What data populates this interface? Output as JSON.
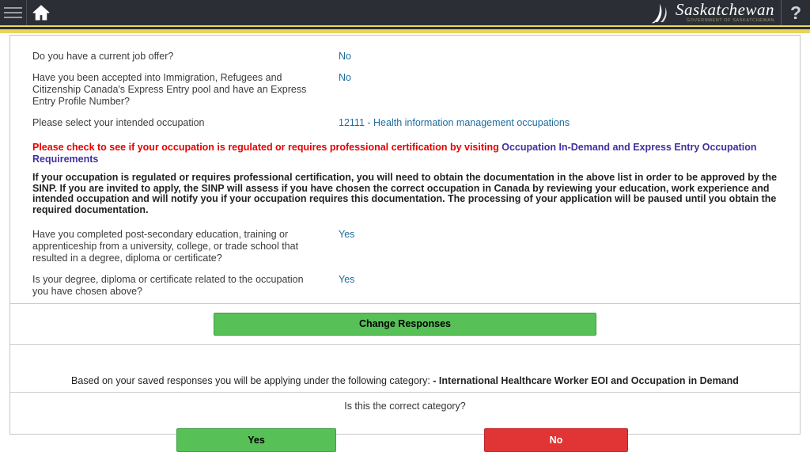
{
  "header": {
    "brand": "Saskatchewan",
    "brand_sub": "GOVERNMENT OF SASKATCHEWAN",
    "help_label": "?"
  },
  "questions": [
    {
      "label": "Do you have a current job offer?",
      "answer": "No"
    },
    {
      "label": "Have you been accepted into Immigration, Refugees and Citizenship Canada's Express Entry pool and have an Express Entry Profile Number?",
      "answer": "No"
    },
    {
      "label": "Please select your intended occupation",
      "answer": "12111 - Health information management occupations"
    },
    {
      "label": "Have you completed post-secondary education, training or apprenticeship from a university, college, or trade school that resulted in a degree, diploma or certificate?",
      "answer": "Yes"
    },
    {
      "label": "Is your degree, diploma or certificate related to the occupation you have chosen above?",
      "answer": "Yes"
    }
  ],
  "warning": {
    "text": "Please check to see if your occupation is regulated or requires professional certification by visiting ",
    "link": "Occupation In-Demand and Express Entry Occupation Requirements"
  },
  "notice": "If your occupation is regulated or requires professional certification, you will need to obtain the documentation in the above list in order to be approved by the SINP. If you are invited to apply, the SINP will assess if you have chosen the correct occupation in Canada by reviewing your education, work experience and intended occupation and will notify you if your occupation requires this documentation. The processing of your application will be paused until you obtain the required documentation.",
  "actions": {
    "change_responses": "Change Responses",
    "yes": "Yes",
    "no": "No"
  },
  "category": {
    "prefix": "Based on your saved responses you will be applying under the following category: ",
    "value": "- International Healthcare Worker EOI and Occupation in Demand",
    "confirm_question": "Is this the correct category?"
  },
  "colors": {
    "header_bg": "#2b2e35",
    "gold_stripe": "#e9d45c",
    "answer_blue": "#1d6d9e",
    "warning_red": "#e60000",
    "link_purple": "#4130a0",
    "green_button": "#57c157",
    "red_button": "#e13434"
  }
}
